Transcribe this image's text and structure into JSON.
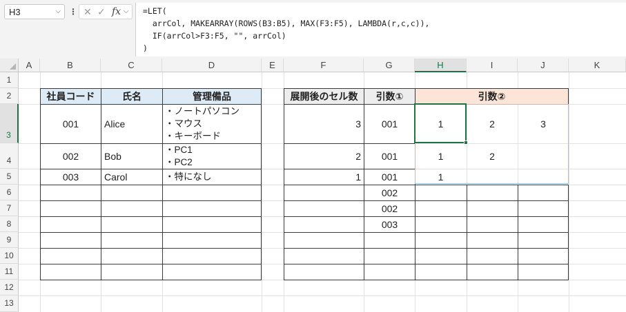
{
  "name_box": "H3",
  "formula_lines": [
    "=LET(",
    "  arrCol, MAKEARRAY(ROWS(B3:B5), MAX(F3:F5), LAMBDA(r,c,c)),",
    "  IF(arrCol>F3:F5, \"\", arrCol)",
    ")"
  ],
  "formula_icons": {
    "more": "⋮",
    "cancel": "✕",
    "enter": "✓",
    "fx": "fx"
  },
  "column_headers": [
    "A",
    "B",
    "C",
    "D",
    "E",
    "F",
    "G",
    "H",
    "I",
    "J",
    "K"
  ],
  "row_headers": [
    "1",
    "2",
    "3",
    "4",
    "5",
    "6",
    "7",
    "8",
    "9",
    "10",
    "11",
    "12",
    "13"
  ],
  "table1": {
    "headers": [
      "社員コード",
      "氏名",
      "管理備品"
    ],
    "rows": [
      {
        "code": "001",
        "name": "Alice",
        "items": [
          "・ノートパソコン",
          "・マウス",
          "・キーボード"
        ]
      },
      {
        "code": "002",
        "name": "Bob",
        "items": [
          "・PC1",
          "・PC2"
        ]
      },
      {
        "code": "003",
        "name": "Carol",
        "items": [
          "・特になし"
        ]
      }
    ]
  },
  "table2": {
    "headers": [
      "展開後のセル数",
      "引数①",
      "引数②"
    ],
    "counts": [
      "3",
      "2",
      "1"
    ],
    "arg1": [
      "001",
      "001",
      "001",
      "002",
      "002",
      "003"
    ],
    "arg2": [
      [
        "1",
        "2",
        "3"
      ],
      [
        "1",
        "2",
        ""
      ],
      [
        "1",
        "",
        ""
      ]
    ]
  }
}
